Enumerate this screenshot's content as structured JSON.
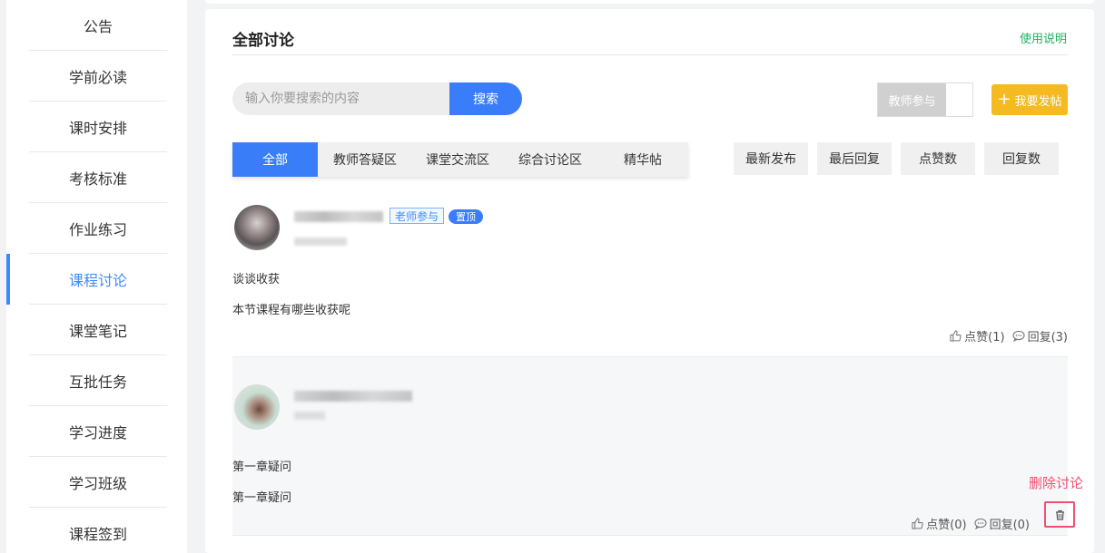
{
  "sidebar": {
    "active_index": 5,
    "items": [
      {
        "label": "公告"
      },
      {
        "label": "学前必读"
      },
      {
        "label": "课时安排"
      },
      {
        "label": "考核标准"
      },
      {
        "label": "作业练习"
      },
      {
        "label": "课程讨论"
      },
      {
        "label": "课堂笔记"
      },
      {
        "label": "互批任务"
      },
      {
        "label": "学习进度"
      },
      {
        "label": "学习班级"
      },
      {
        "label": "课程签到"
      }
    ]
  },
  "header": {
    "title": "全部讨论",
    "help_link": "使用说明"
  },
  "search": {
    "placeholder": "输入你要搜索的内容",
    "button": "搜索"
  },
  "teacher_toggle": {
    "label": "教师参与"
  },
  "post_button": {
    "icon": "plus-icon",
    "label": "我要发帖"
  },
  "tabs": [
    {
      "label": "全部",
      "active": true
    },
    {
      "label": "教师答疑区",
      "active": false
    },
    {
      "label": "课堂交流区",
      "active": false
    },
    {
      "label": "综合讨论区",
      "active": false
    },
    {
      "label": "精华帖",
      "active": false
    }
  ],
  "sort_buttons": [
    {
      "label": "最新发布"
    },
    {
      "label": "最后回复"
    },
    {
      "label": "点赞数"
    },
    {
      "label": "回复数"
    }
  ],
  "posts": [
    {
      "tags": {
        "teacher": "老师参与",
        "top": "置顶"
      },
      "title": "谈谈收获",
      "body": "本节课程有哪些收获呢",
      "likes": "点赞(1)",
      "replies": "回复(3)"
    },
    {
      "title": "第一章疑问",
      "body": "第一章疑问",
      "likes": "点赞(0)",
      "replies": "回复(0)",
      "delete_icon": "trash-icon"
    }
  ],
  "annotation": {
    "delete_label": "删除讨论",
    "color": "#f0506e"
  },
  "colors": {
    "accent": "#3a7df8",
    "help_link": "#1db45b",
    "post_button": "#f5b921"
  }
}
